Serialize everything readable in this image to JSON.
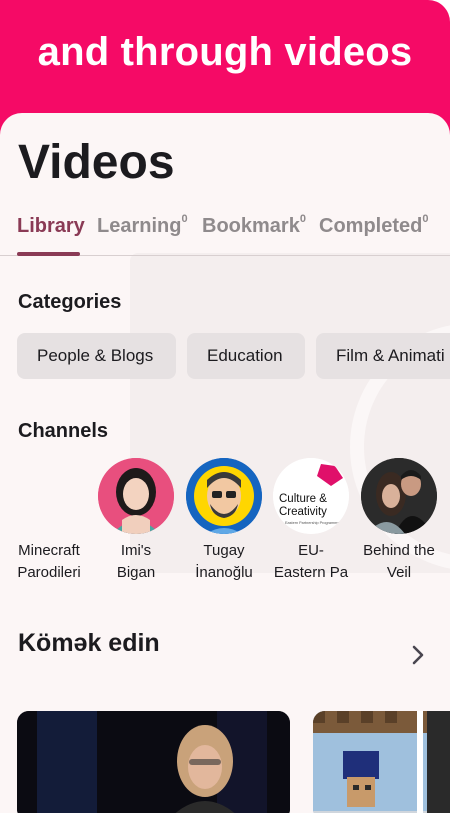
{
  "banner": {
    "text": "and through videos"
  },
  "page": {
    "title": "Videos"
  },
  "tabs": [
    {
      "label": "Library",
      "count": ""
    },
    {
      "label": "Learning",
      "count": "0"
    },
    {
      "label": "Bookmark",
      "count": "0"
    },
    {
      "label": "Completed",
      "count": "0"
    }
  ],
  "categories": {
    "heading": "Categories",
    "items": [
      "People & Blogs",
      "Education",
      "Film & Animati"
    ]
  },
  "channels": {
    "heading": "Channels",
    "items": [
      {
        "line1": "Minecraft",
        "line2": "Parodileri"
      },
      {
        "line1": "Imi's",
        "line2": "Bigan"
      },
      {
        "line1": "Tugay",
        "line2": "İnanoğlu"
      },
      {
        "line1": "EU-",
        "line2": "Eastern Pa"
      },
      {
        "line1": "Behind the",
        "line2": "Veil"
      }
    ],
    "logo_text": {
      "line1": "Culture &",
      "line2": "Creativity",
      "line3": "Eastern Partnership Programme"
    }
  },
  "help_section": {
    "title": "Kömək edin"
  },
  "colors": {
    "brand": "#f50a66",
    "accent": "#8a3a55",
    "chip": "#e6e1e2",
    "sheet": "#fcf6f6"
  }
}
